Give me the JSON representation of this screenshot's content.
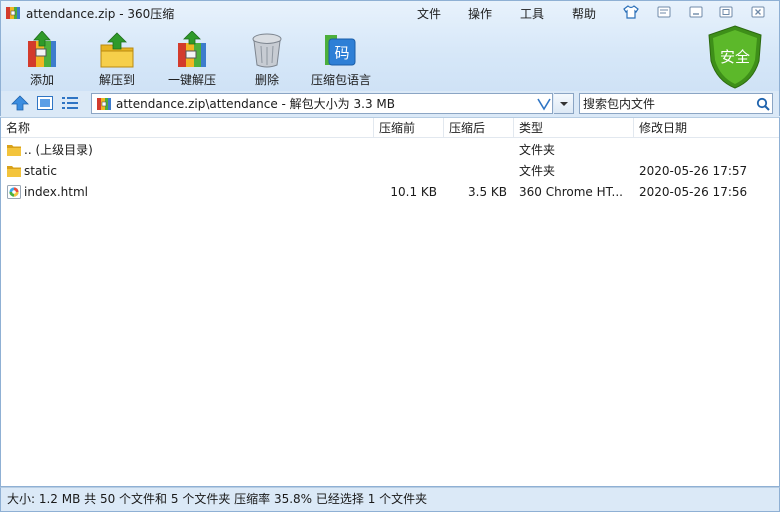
{
  "window": {
    "title": "attendance.zip - 360压缩"
  },
  "menu": {
    "file": "文件",
    "operate": "操作",
    "tools": "工具",
    "help": "帮助"
  },
  "toolbar": {
    "add": "添加",
    "extract_to": "解压到",
    "one_click_extract": "一键解压",
    "delete": "删除",
    "encoding": "压缩包语言"
  },
  "security": {
    "label": "安全",
    "color": "#4a9e1f"
  },
  "address": {
    "value": "attendance.zip\\attendance - 解包大小为 3.3 MB"
  },
  "search": {
    "placeholder": "搜索包内文件"
  },
  "columns": {
    "name": "名称",
    "compressed_before": "压缩前",
    "compressed_after": "压缩后",
    "type": "类型",
    "modified": "修改日期"
  },
  "files": [
    {
      "name": ".. (上级目录)",
      "size_before": "",
      "size_after": "",
      "type": "文件夹",
      "modified": "",
      "icon": "folder-icon"
    },
    {
      "name": "static",
      "size_before": "",
      "size_after": "",
      "type": "文件夹",
      "modified": "2020-05-26 17:57",
      "icon": "folder-icon"
    },
    {
      "name": "index.html",
      "size_before": "10.1 KB",
      "size_after": "3.5 KB",
      "type": "360 Chrome HT...",
      "modified": "2020-05-26 17:56",
      "icon": "html-file-icon"
    }
  ],
  "status": {
    "text": "大小: 1.2 MB 共 50 个文件和 5 个文件夹 压缩率 35.8% 已经选择 1 个文件夹"
  },
  "colors": {
    "accent": "#1e6fc2",
    "folder": "#e8b421",
    "frame": "#8fb0d4"
  }
}
